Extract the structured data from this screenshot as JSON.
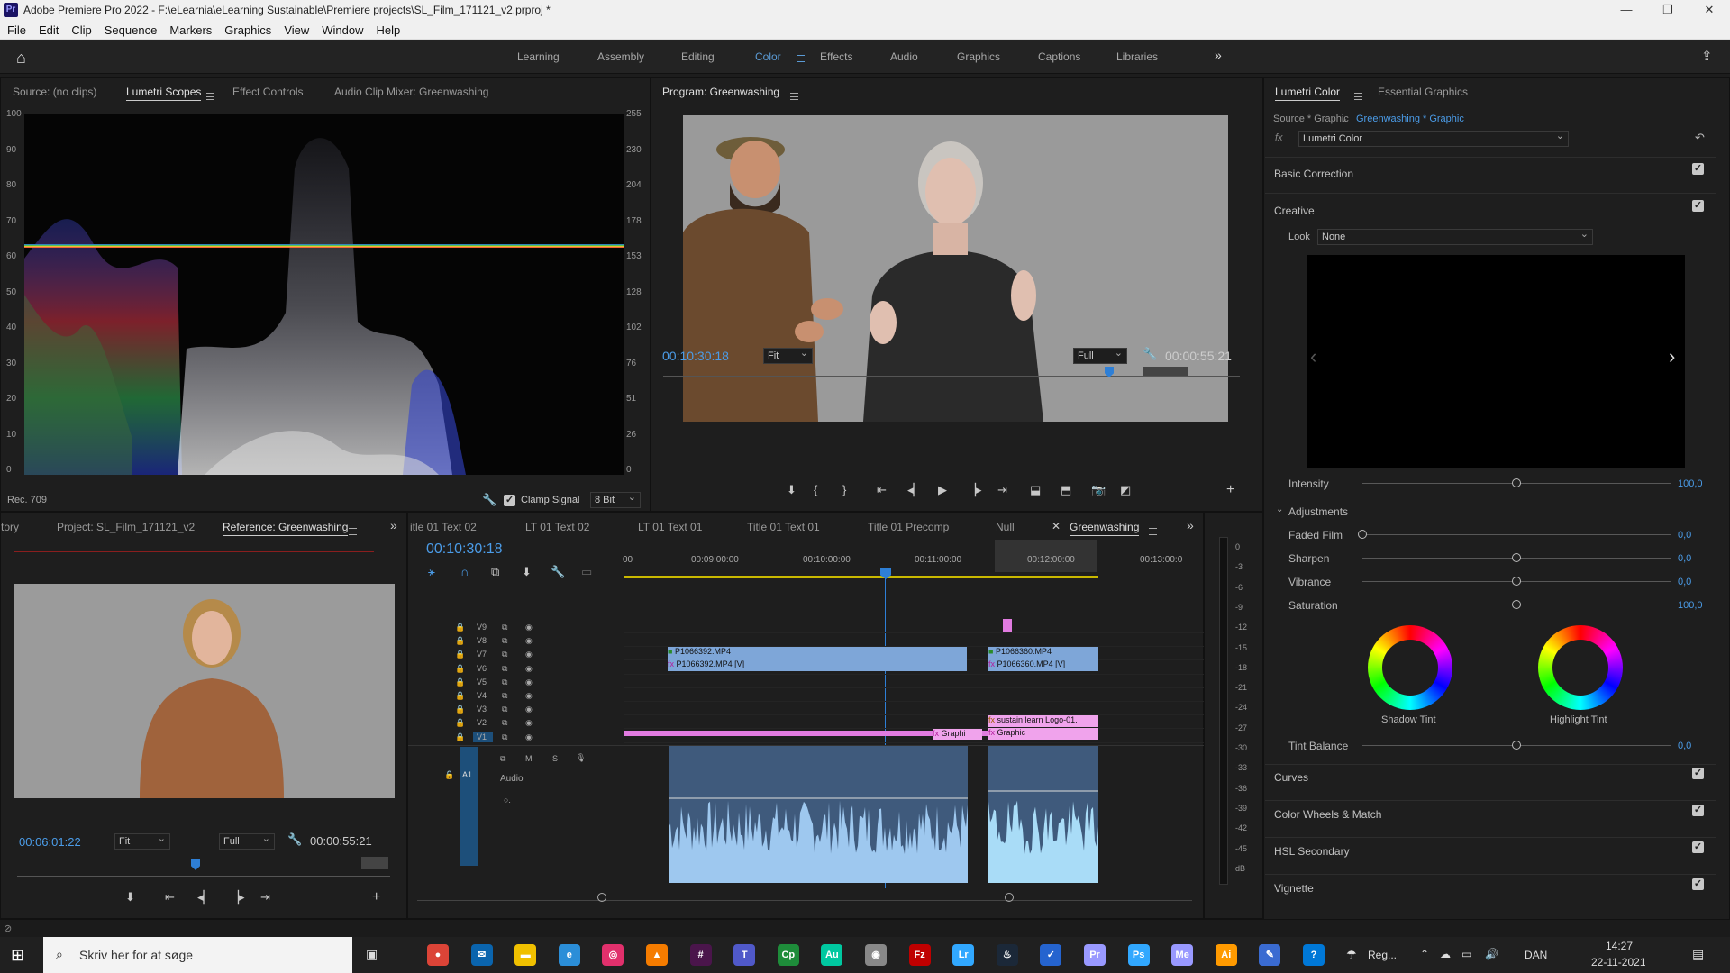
{
  "window": {
    "title": "Adobe Premiere Pro 2022 - F:\\eLearnia\\eLearning Sustainable\\Premiere projects\\SL_Film_171121_v2.prproj *",
    "app_icon": "Pr"
  },
  "menu": [
    "File",
    "Edit",
    "Clip",
    "Sequence",
    "Markers",
    "Graphics",
    "View",
    "Window",
    "Help"
  ],
  "workspaces": {
    "items": [
      "Learning",
      "Assembly",
      "Editing",
      "Color",
      "Effects",
      "Audio",
      "Graphics",
      "Captions",
      "Libraries"
    ],
    "active": "Color",
    "overflow": "»"
  },
  "source_panel": {
    "tabs": [
      "Source: (no clips)",
      "Lumetri Scopes",
      "Effect Controls",
      "Audio Clip Mixer: Greenwashing"
    ],
    "active_tab": "Lumetri Scopes",
    "scale_left": [
      "100",
      "90",
      "80",
      "70",
      "60",
      "50",
      "40",
      "30",
      "20",
      "10",
      "0"
    ],
    "scale_right": [
      "255",
      "230",
      "204",
      "178",
      "153",
      "128",
      "102",
      "76",
      "51",
      "26",
      "0"
    ],
    "footer_left": "Rec. 709",
    "clamp_signal": "Clamp Signal",
    "bit_depth": "8 Bit"
  },
  "program_panel": {
    "title": "Program: Greenwashing",
    "timecode": "00:10:30:18",
    "fit": "Fit",
    "resolution": "Full",
    "duration": "00:00:55:21"
  },
  "lumetri": {
    "tabs": [
      "Lumetri Color",
      "Essential Graphics"
    ],
    "active_tab": "Lumetri Color",
    "source": "Source * Graphic",
    "sequence": "Greenwashing * Graphic",
    "fx": "fx",
    "effect": "Lumetri Color",
    "sections": {
      "basic": "Basic Correction",
      "creative": "Creative",
      "curves": "Curves",
      "wheels": "Color Wheels & Match",
      "hsl": "HSL Secondary",
      "vignette": "Vignette"
    },
    "look_label": "Look",
    "look_value": "None",
    "intensity": {
      "label": "Intensity",
      "value": "100,0",
      "level": 0.5
    },
    "adjustments": "Adjustments",
    "sliders": [
      {
        "label": "Faded Film",
        "value": "0,0",
        "level": 0.0
      },
      {
        "label": "Sharpen",
        "value": "0,0",
        "level": 0.5
      },
      {
        "label": "Vibrance",
        "value": "0,0",
        "level": 0.5
      },
      {
        "label": "Saturation",
        "value": "100,0",
        "level": 0.5
      }
    ],
    "shadow_tint": "Shadow Tint",
    "highlight_tint": "Highlight Tint",
    "tint_balance": {
      "label": "Tint Balance",
      "value": "0,0",
      "level": 0.5
    }
  },
  "project_panel": {
    "tabs": [
      "tory",
      "Project: SL_Film_171121_v2",
      "Reference: Greenwashing"
    ],
    "active_tab": "Reference: Greenwashing",
    "timecode": "00:06:01:22",
    "fit": "Fit",
    "resolution": "Full",
    "duration": "00:00:55:21"
  },
  "timeline": {
    "tabs": [
      "itle 01 Text 02",
      "LT 01 Text 02",
      "LT 01 Text 01",
      "Title 01 Text 01",
      "Title 01 Precomp",
      "Null",
      "Greenwashing"
    ],
    "active_tab": "Greenwashing",
    "timecode": "00:10:30:18",
    "ruler": [
      "00",
      "00:09:00:00",
      "00:10:00:00",
      "00:11:00:00",
      "00:12:00:00",
      "00:13:00:0"
    ],
    "video_tracks": [
      "V9",
      "V8",
      "V7",
      "V6",
      "V5",
      "V4",
      "V3",
      "V2",
      "V1"
    ],
    "audio_track": "A1",
    "audio_name": "Audio",
    "clips": {
      "v7_a": "P1066392.MP4",
      "v6_a": "P1066392.MP4 [V]",
      "v7_b": "P1066360.MP4",
      "v6_b": "P1066360.MP4 [V]",
      "v2_b": "sustain learn Logo-01.",
      "v1_b": "Graphic",
      "v1_a": "Graphi"
    },
    "meter_scale": [
      "0",
      "-3",
      "-6",
      "-9",
      "-12",
      "-15",
      "-18",
      "-21",
      "-24",
      "-27",
      "-30",
      "-33",
      "-36",
      "-39",
      "-42",
      "-45",
      "dB"
    ]
  },
  "taskbar": {
    "search_placeholder": "Skriv her for at søge",
    "icons": [
      "chrome-icon",
      "outlook-icon",
      "explorer-icon",
      "edge-icon",
      "instagram-icon",
      "vlc-icon",
      "slack-icon",
      "teams-icon",
      "captivate-icon",
      "audition-icon",
      "app-icon",
      "filezilla-icon",
      "lightroom-icon",
      "steam-icon",
      "todo-icon",
      "premiere-icon",
      "photoshop-icon",
      "media-encoder-icon",
      "illustrator-icon",
      "notepad-icon",
      "help-icon"
    ],
    "weather": "Reg...",
    "language": "DAN",
    "time": "14:27",
    "date": "22-11-2021"
  }
}
